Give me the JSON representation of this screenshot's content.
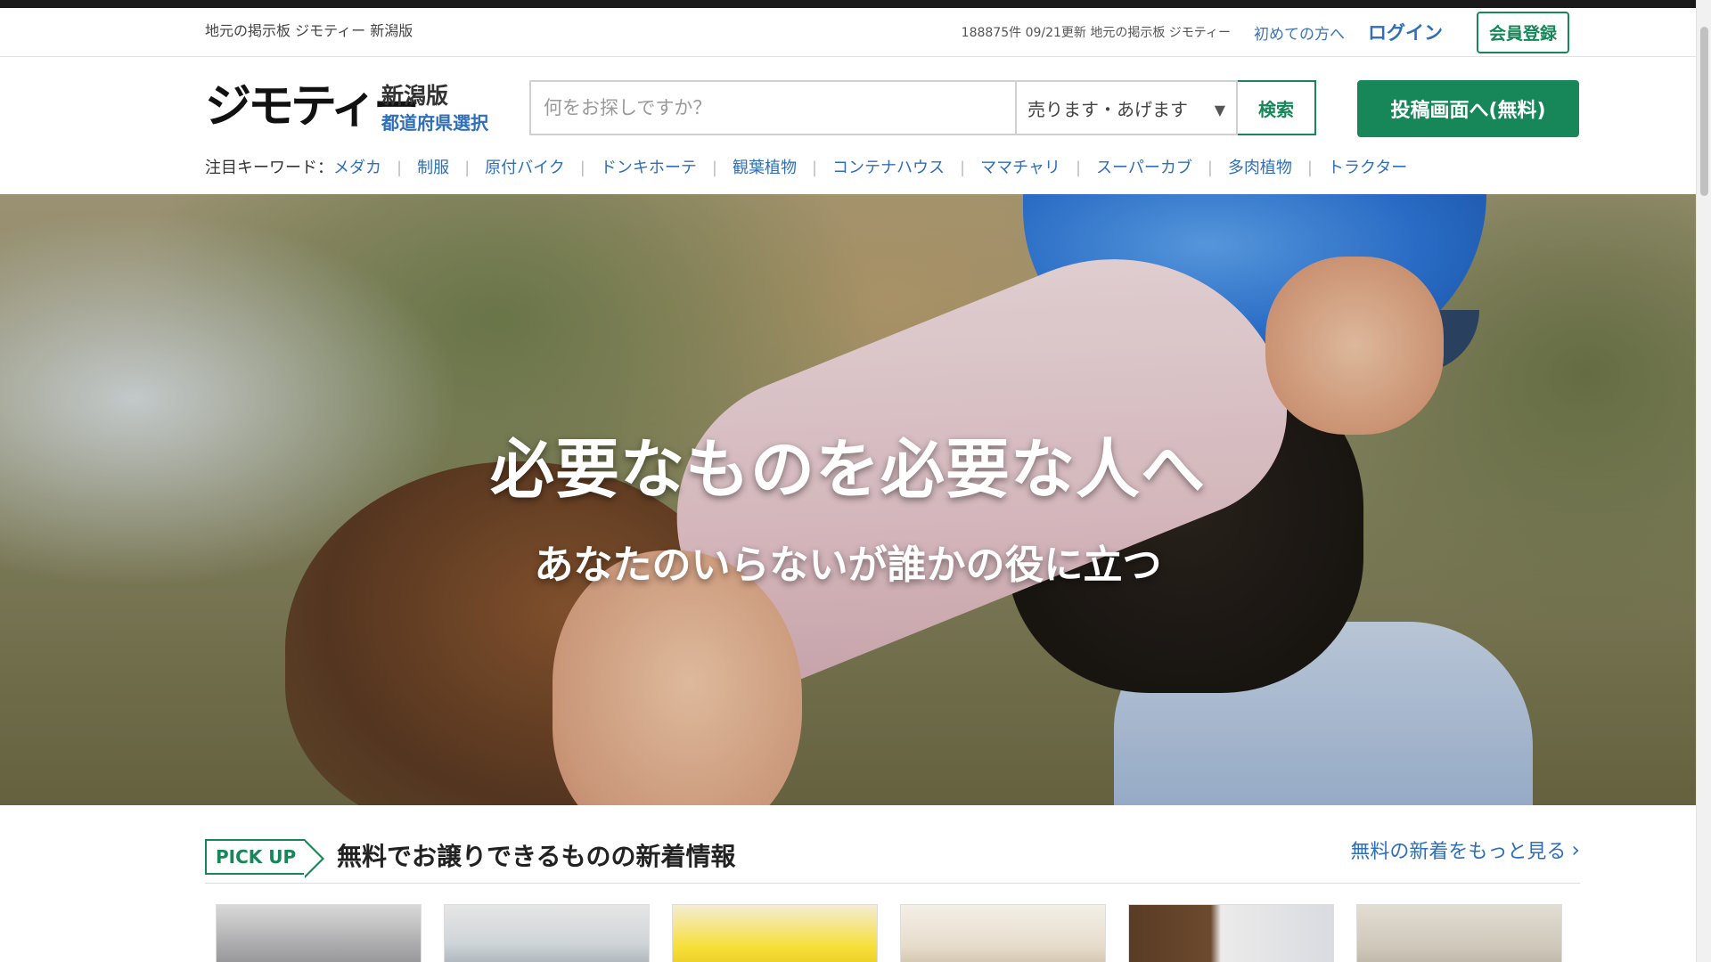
{
  "utility": {
    "site_label": "地元の掲示板 ジモティー 新潟版",
    "stats": "188875件 09/21更新 地元の掲示板 ジモティー",
    "first_time": "初めての方へ",
    "login": "ログイン",
    "register": "会員登録"
  },
  "header": {
    "logo": "ジモティー",
    "region": "新潟版",
    "region_select": "都道府県選択",
    "search_placeholder": "何をお探しですか？",
    "category": "売ります・あげます",
    "search_button": "検索",
    "post_button": "投稿画面へ(無料)"
  },
  "keywords": {
    "label": "注目キーワード：",
    "items": [
      "メダカ",
      "制服",
      "原付バイク",
      "ドンキホーテ",
      "観葉植物",
      "コンテナハウス",
      "ママチャリ",
      "スーパーカブ",
      "多肉植物",
      "トラクター"
    ]
  },
  "hero": {
    "title": "必要なものを必要な人へ",
    "subtitle": "あなたのいらないが誰かの役に立つ"
  },
  "pickup": {
    "badge": "PICK UP",
    "title": "無料でお譲りできるものの新着情報",
    "more": "無料の新着をもっと見る"
  },
  "icons": {
    "dropdown": "chevron-down-icon",
    "more": "chevron-right-icon"
  },
  "colors": {
    "brand_green": "#17875a",
    "link_blue": "#2f6fb8"
  }
}
